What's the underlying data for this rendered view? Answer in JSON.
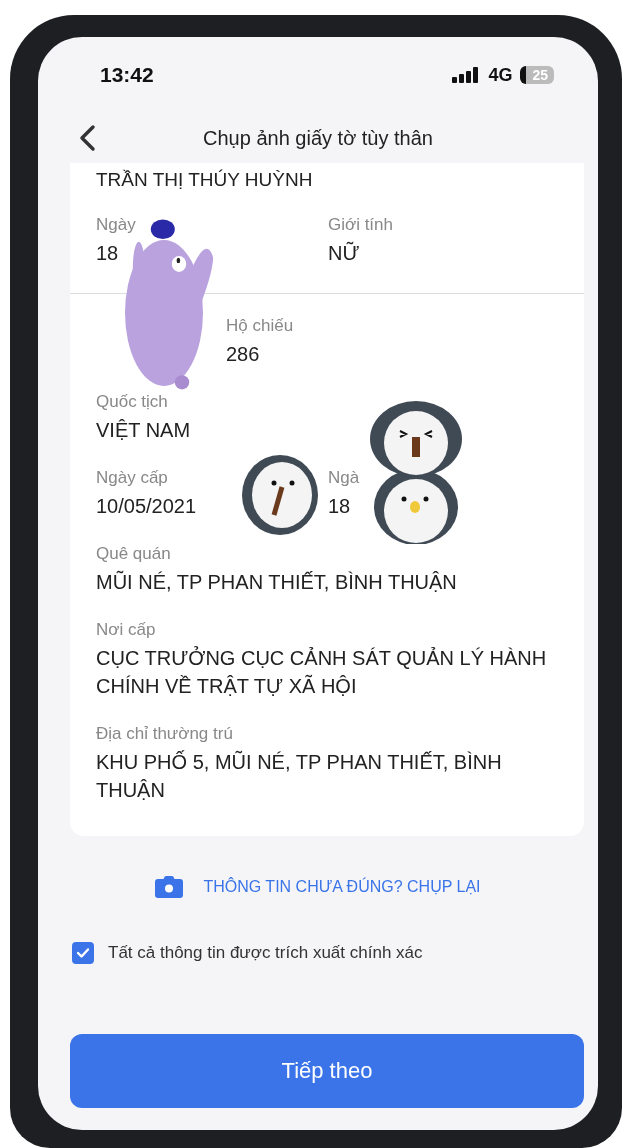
{
  "status_bar": {
    "time": "13:42",
    "network": "4G",
    "battery": "25"
  },
  "header": {
    "title": "Chụp ảnh giấy tờ tùy thân"
  },
  "card": {
    "name": "TRẦN THỊ THÚY HUỲNH",
    "rows": [
      {
        "fields": [
          {
            "label": "Ngày",
            "value": "18",
            "hidden_start": false
          },
          {
            "label": "Giới tính",
            "value": "NỮ",
            "hidden_start": false
          }
        ]
      },
      {
        "fields": [
          {
            "label": "Hộ chiếu",
            "value": "286",
            "hidden_start": true
          }
        ]
      },
      {
        "fields": [
          {
            "label": "Quốc tịch",
            "value": "VIỆT NAM",
            "hidden_start": false
          }
        ]
      },
      {
        "fields": [
          {
            "label": "Ngày cấp",
            "value": "10/05/2021",
            "hidden_start": false
          },
          {
            "label": "Ngà",
            "value": "18",
            "hidden_start": false
          }
        ]
      },
      {
        "fields": [
          {
            "label": "Quê quán",
            "value": "MŨI NÉ, TP PHAN THIẾT, BÌNH THUẬN",
            "hidden_start": false
          }
        ]
      },
      {
        "fields": [
          {
            "label": "Nơi cấp",
            "value": "CỤC TRƯỞNG CỤC CẢNH SÁT QUẢN LÝ HÀNH CHÍNH VỀ TRẬT TỰ XÃ HỘI",
            "hidden_start": false
          }
        ]
      },
      {
        "fields": [
          {
            "label": "Địa chỉ thường trú",
            "value": "KHU PHỐ 5, MŨI NÉ, TP PHAN THIẾT, BÌNH THUẬN",
            "hidden_start": false
          }
        ]
      }
    ]
  },
  "retake_link": "THÔNG TIN CHƯA ĐÚNG? CHỤP LẠI",
  "confirm": {
    "label": "Tất cả thông tin được trích xuất chính xác",
    "checked": true
  },
  "next_button": "Tiếp theo"
}
